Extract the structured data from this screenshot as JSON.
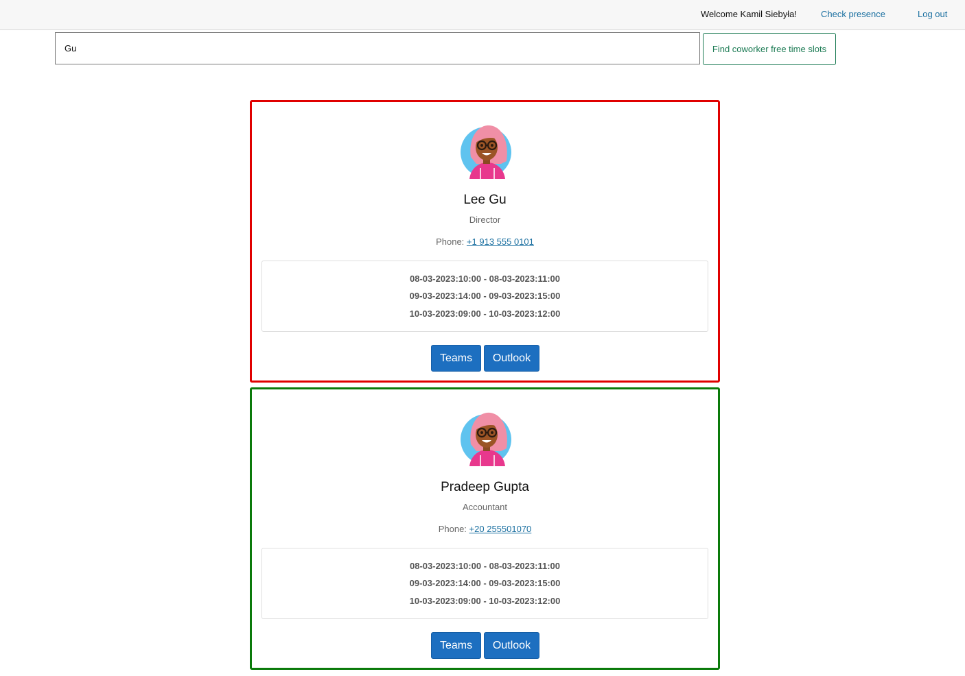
{
  "header": {
    "welcome_text": "Welcome Kamil Siebyła!",
    "check_presence_label": "Check presence",
    "logout_label": "Log out"
  },
  "search": {
    "value": "Gu",
    "button_label": "Find coworker free time slots"
  },
  "cards": [
    {
      "name": "Lee Gu",
      "role": "Director",
      "phone_label": "Phone:",
      "phone": "+1 913 555 0101",
      "border_color": "#e00000",
      "avatar_icon": "person-avatar-icon",
      "slots": [
        "08-03-2023:10:00 - 08-03-2023:11:00",
        "09-03-2023:14:00 - 09-03-2023:15:00",
        "10-03-2023:09:00 - 10-03-2023:12:00"
      ],
      "teams_label": "Teams",
      "outlook_label": "Outlook"
    },
    {
      "name": "Pradeep Gupta",
      "role": "Accountant",
      "phone_label": "Phone:",
      "phone": "+20 255501070",
      "border_color": "#0a7a0a",
      "avatar_icon": "person-avatar-icon",
      "slots": [
        "08-03-2023:10:00 - 08-03-2023:11:00",
        "09-03-2023:14:00 - 09-03-2023:15:00",
        "10-03-2023:09:00 - 10-03-2023:12:00"
      ],
      "teams_label": "Teams",
      "outlook_label": "Outlook"
    }
  ],
  "colors": {
    "primary_button": "#1d6fc0",
    "link": "#1a6fa0",
    "find_button": "#1b7a53"
  }
}
